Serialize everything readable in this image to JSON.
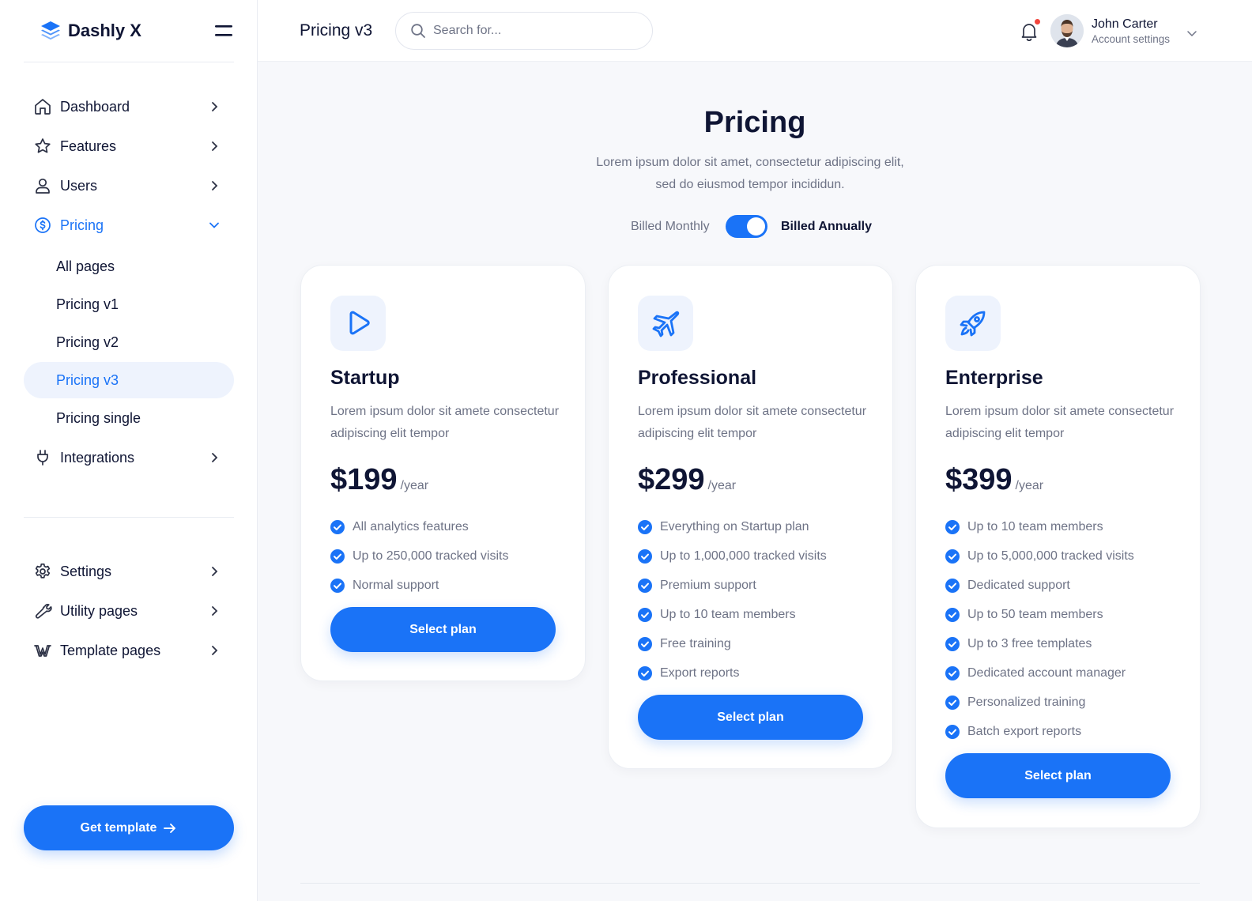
{
  "brand": {
    "name": "Dashly X",
    "accent": "#1a73f7"
  },
  "sidebar": {
    "items": [
      {
        "label": "Dashboard",
        "icon": "home-icon"
      },
      {
        "label": "Features",
        "icon": "star-icon"
      },
      {
        "label": "Users",
        "icon": "user-icon"
      },
      {
        "label": "Pricing",
        "icon": "dollar-circle-icon",
        "expanded": true
      }
    ],
    "subitems": [
      "All pages",
      "Pricing v1",
      "Pricing v2",
      "Pricing v3",
      "Pricing single"
    ],
    "current_subitem": "Pricing v3",
    "integrations": {
      "label": "Integrations",
      "icon": "plug-icon"
    },
    "bottom_items": [
      {
        "label": "Settings",
        "icon": "gear-icon"
      },
      {
        "label": "Utility pages",
        "icon": "wrench-icon"
      },
      {
        "label": "Template pages",
        "icon": "webflow-icon"
      }
    ],
    "cta_label": "Get template"
  },
  "header": {
    "title": "Pricing v3",
    "search_placeholder": "Search for...",
    "user_name": "John Carter",
    "user_subtitle": "Account settings",
    "has_notification": true
  },
  "main": {
    "heading": "Pricing",
    "subtitle": "Lorem ipsum dolor sit amet, consectetur adipiscing elit, sed do eiusmod tempor incididun.",
    "billing_monthly": "Billed Monthly",
    "billing_annual": "Billed Annually",
    "billing_toggle_annual": true
  },
  "plans": [
    {
      "name": "Startup",
      "icon": "play-icon",
      "description": "Lorem ipsum dolor sit amete consectetur adipiscing elit tempor",
      "price": "$199",
      "period": "/year",
      "features": [
        "All analytics features",
        "Up to 250,000 tracked visits",
        "Normal support"
      ],
      "button": "Select plan"
    },
    {
      "name": "Professional",
      "icon": "airplane-icon",
      "description": "Lorem ipsum dolor sit amete consectetur adipiscing elit tempor",
      "price": "$299",
      "period": "/year",
      "features": [
        "Everything on Startup plan",
        "Up to 1,000,000 tracked visits",
        "Premium support",
        "Up to 10 team members",
        "Free training",
        "Export reports"
      ],
      "button": "Select plan"
    },
    {
      "name": "Enterprise",
      "icon": "rocket-icon",
      "description": "Lorem ipsum dolor sit amete consectetur adipiscing elit tempor",
      "price": "$399",
      "period": "/year",
      "features": [
        "Up to 10 team members",
        "Up to 5,000,000 tracked visits",
        "Dedicated support",
        "Up to 50 team members",
        "Up to 3 free templates",
        "Dedicated account manager",
        "Personalized training",
        "Batch export reports"
      ],
      "button": "Select plan"
    }
  ]
}
